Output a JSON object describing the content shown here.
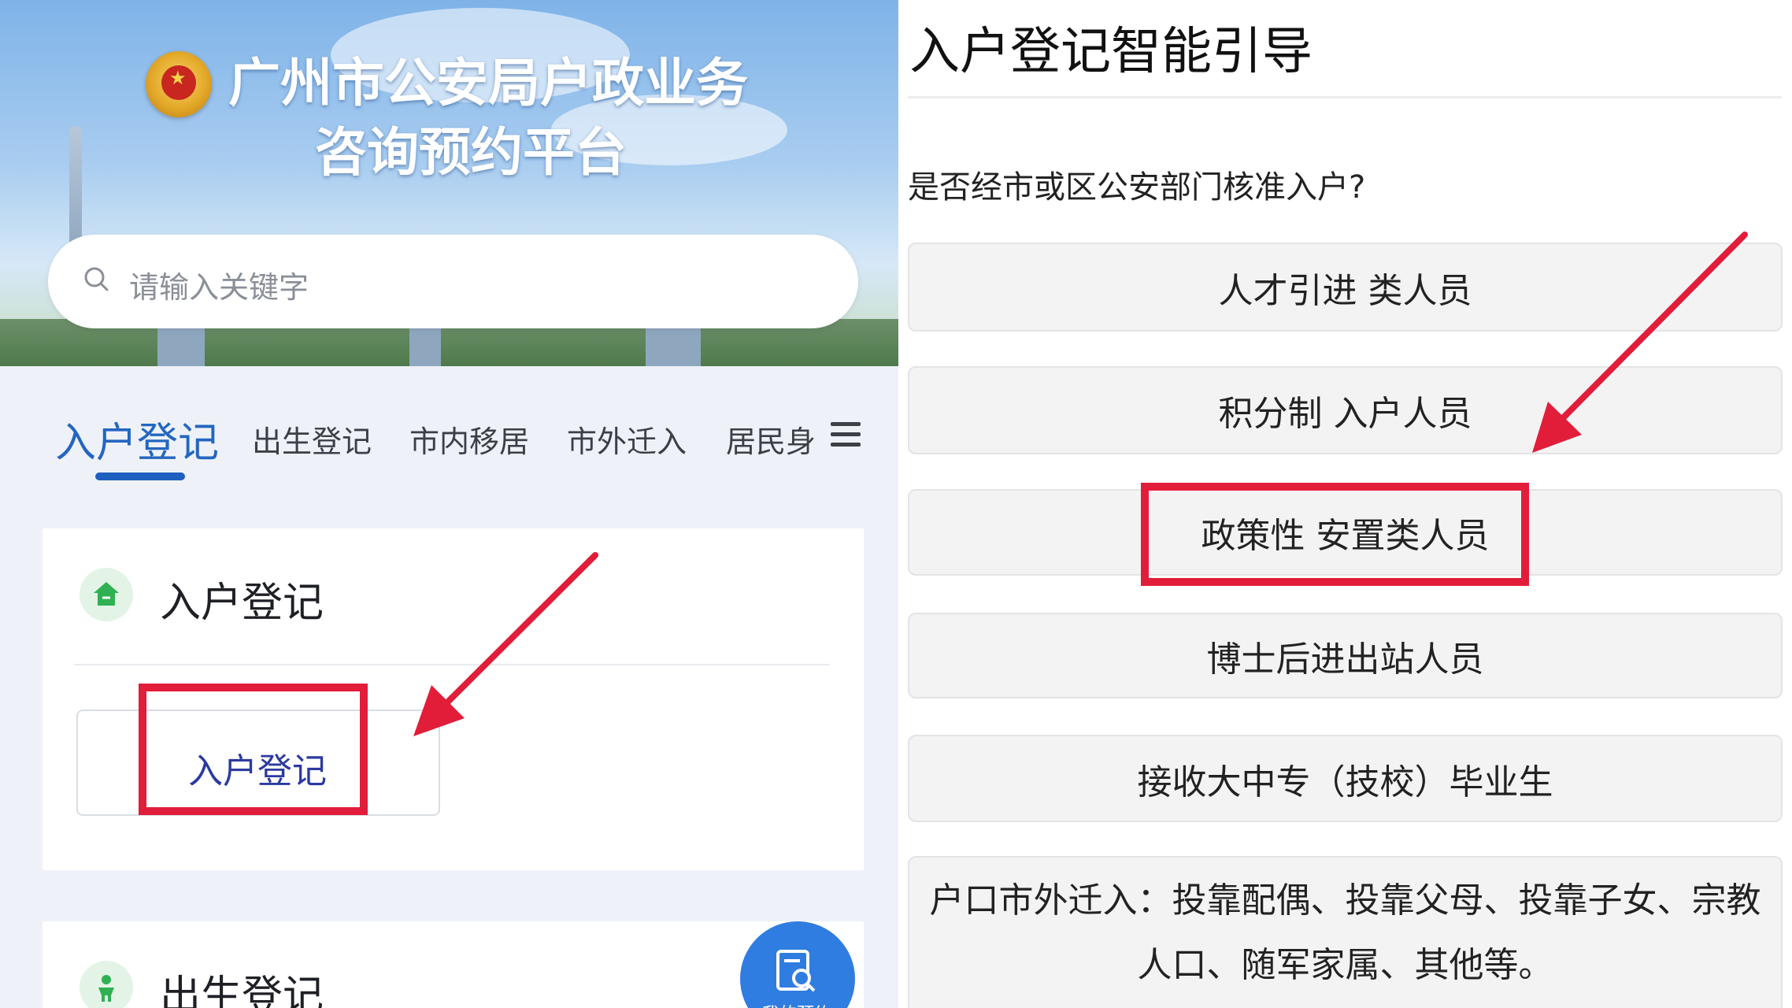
{
  "left": {
    "banner": {
      "title_line1": "广州市公安局户政业务",
      "title_line2": "咨询预约平台",
      "emblem_icon": "police-emblem-icon"
    },
    "search": {
      "placeholder": "请输入关键字",
      "icon": "search-icon"
    },
    "tabs": [
      {
        "label": "入户登记",
        "active": true
      },
      {
        "label": "出生登记",
        "active": false
      },
      {
        "label": "市内移居",
        "active": false
      },
      {
        "label": "市外迁入",
        "active": false
      },
      {
        "label": "居民身",
        "active": false
      }
    ],
    "menu_icon": "menu-icon",
    "card1": {
      "icon": "house-icon",
      "heading": "入户登记",
      "button_label": "入户登记"
    },
    "card2": {
      "icon": "baby-icon",
      "heading": "出生登记"
    },
    "float_button": {
      "icon": "search-document-icon",
      "label": "我的预约"
    }
  },
  "right": {
    "title": "入户登记智能引导",
    "question": "是否经市或区公安部门核准入户?",
    "options": [
      "人才引进 类人员",
      "积分制 入户人员",
      "政策性 安置类人员",
      "博士后进出站人员",
      "接收大中专（技校）毕业生",
      "户口市外迁入：投靠配偶、投靠父母、投靠子女、宗教人口、随军家属、其他等。"
    ]
  },
  "colors": {
    "accent_blue": "#2466c0",
    "highlight_red": "#e11d3a",
    "float_button": "#2f7de0"
  }
}
